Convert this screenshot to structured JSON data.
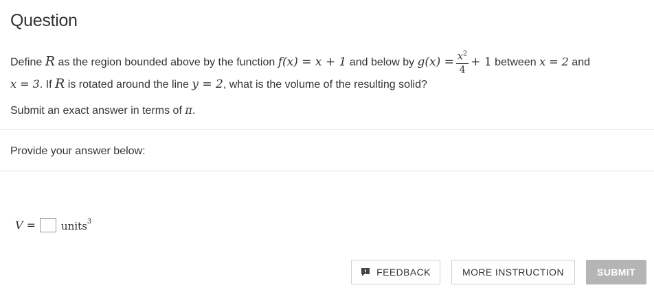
{
  "header": {
    "title": "Question"
  },
  "question": {
    "line1": {
      "t1": "Define ",
      "R": "R",
      "t2": " as the region bounded above by the function ",
      "f_def": "f(x) = x + 1",
      "t3": " and below by ",
      "g_lhs": "g(x) =",
      "frac_num": "x",
      "frac_num_exp": "2",
      "frac_den": "4",
      "g_tail": "+ 1",
      "t4": " between ",
      "x_eq_2": "x = 2",
      "t5": " and"
    },
    "line2": {
      "x_eq_3": "x = 3",
      "t1": ". If ",
      "R": "R",
      "t2": " is rotated around the line ",
      "y_eq": "y = 2",
      "t3": ", what is the volume of the resulting solid?"
    },
    "instruction": {
      "t1": "Submit an exact answer in terms of ",
      "pi": "π",
      "t2": "."
    }
  },
  "answer": {
    "prompt": "Provide your answer below:",
    "variable": "V =",
    "input_value": "",
    "units": "units",
    "units_exp": "3"
  },
  "buttons": {
    "feedback": "FEEDBACK",
    "more_instruction": "MORE INSTRUCTION",
    "submit": "SUBMIT"
  },
  "colors": {
    "submit_bg": "#b5b5b5",
    "divider": "#e3e3e3",
    "text": "#333333"
  },
  "icons": {
    "feedback": "feedback-chat-icon"
  }
}
